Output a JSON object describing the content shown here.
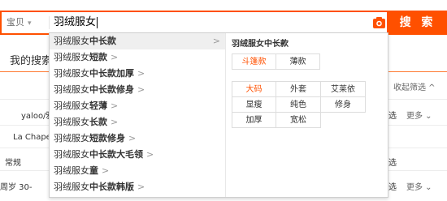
{
  "search": {
    "category": "宝贝",
    "query": "羽绒服女",
    "button": "搜 索"
  },
  "background": {
    "my_search": "我的搜索",
    "shrink_filter": "收起筛选 ^",
    "rows": [
      {
        "left": "yaloo/雅",
        "right_suffix": "选",
        "more": "更多"
      },
      {
        "left": "La Chape",
        "right_suffix": "",
        "more": ""
      },
      {
        "left": "常规",
        "right_suffix": "选",
        "more": ""
      },
      {
        "left": "周岁 30-",
        "right_suffix": "选",
        "more": "更多"
      }
    ]
  },
  "dropdown": {
    "suggestions": [
      {
        "base": "羽绒服女",
        "bold": "中长款",
        "tail": "",
        "chevron": ">",
        "active": true
      },
      {
        "base": "羽绒服女",
        "bold": "短款",
        "tail": "",
        "chevron": ">"
      },
      {
        "base": "羽绒服女",
        "bold": "中长款加厚",
        "tail": "",
        "chevron": ">"
      },
      {
        "base": "羽绒服女",
        "bold": "中长款修身",
        "tail": "",
        "chevron": ">"
      },
      {
        "base": "羽绒服女",
        "bold": "轻薄",
        "tail": "",
        "chevron": ">"
      },
      {
        "base": "羽绒服女",
        "bold": "长款",
        "tail": "",
        "chevron": ">"
      },
      {
        "base": "羽绒服女",
        "bold": "短款修身",
        "tail": "",
        "chevron": ">"
      },
      {
        "base": "羽绒服女",
        "bold": "中长款大毛领",
        "tail": "",
        "chevron": ">"
      },
      {
        "base": "羽绒服女",
        "bold": "童",
        "tail": "",
        "chevron": ">"
      },
      {
        "base": "羽绒服女",
        "bold": "中长款韩版",
        "tail": "",
        "chevron": ">"
      }
    ],
    "panel": {
      "title": "羽绒服女中长款",
      "group1": [
        "斗篷款",
        "薄款"
      ],
      "group2": [
        "大码",
        "外套",
        "艾莱依",
        "显瘦",
        "纯色",
        "修身",
        "加厚",
        "宽松"
      ]
    }
  },
  "colors": {
    "accent": "#ff5000",
    "hot_chip": "#ff5000"
  }
}
